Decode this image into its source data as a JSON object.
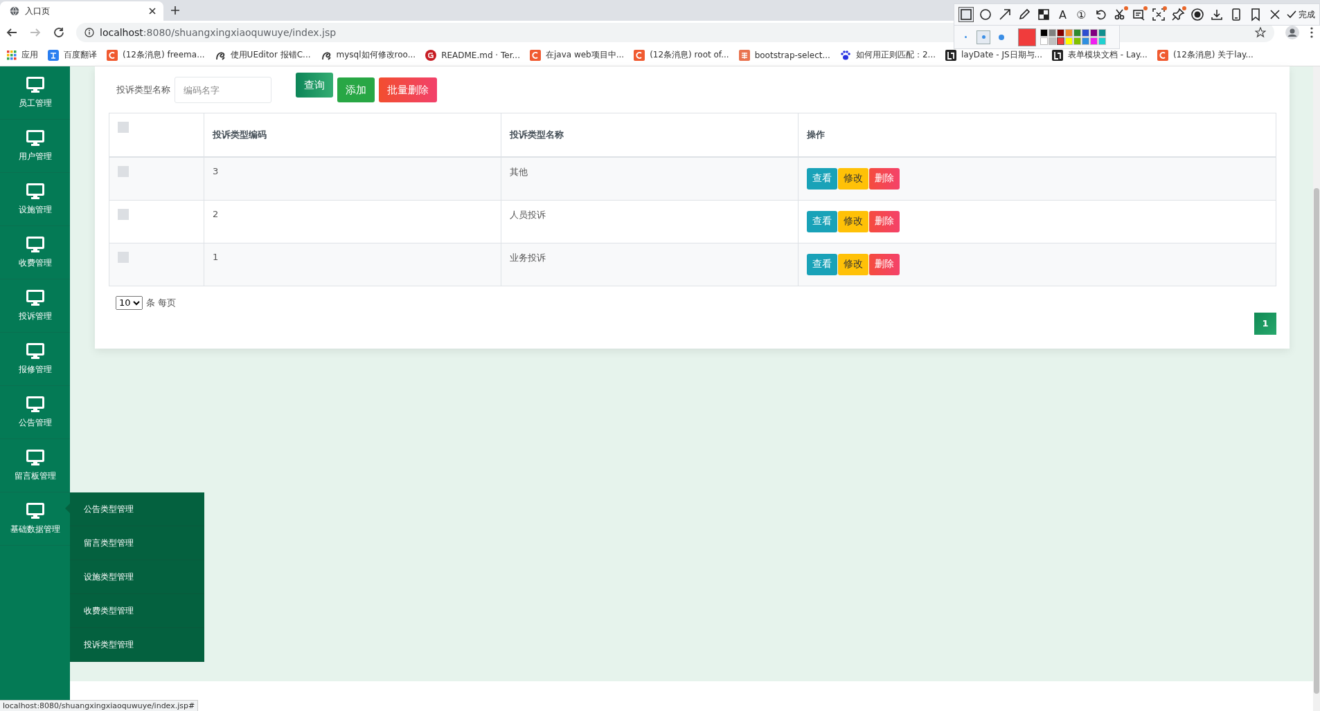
{
  "browser": {
    "tab_title": "入口页",
    "url_host": "localhost",
    "url_path": ":8080/shuangxingxiaoquwuye/index.jsp",
    "bookmarks": [
      {
        "label": "应用",
        "kind": "apps"
      },
      {
        "label": "百度翻译",
        "kind": "translate"
      },
      {
        "label": "(12条消息) freema...",
        "kind": "csdn"
      },
      {
        "label": "使用UEditor 报错C...",
        "kind": "swirl"
      },
      {
        "label": "mysql如何修改roo...",
        "kind": "swirl"
      },
      {
        "label": "README.md · Ter...",
        "kind": "gitee"
      },
      {
        "label": "在java web项目中...",
        "kind": "csdn"
      },
      {
        "label": "(12条消息) root of...",
        "kind": "csdn"
      },
      {
        "label": "bootstrap-select...",
        "kind": "jian"
      },
      {
        "label": "如何用正则匹配：2...",
        "kind": "paw"
      },
      {
        "label": "layDate - JS日期与...",
        "kind": "layui"
      },
      {
        "label": "表单模块文档 - Lay...",
        "kind": "layui"
      },
      {
        "label": "(12条消息) 关于lay...",
        "kind": "csdn"
      }
    ]
  },
  "annotation_toolbar": {
    "tools": [
      {
        "kind": "rect",
        "selected": true
      },
      {
        "kind": "ellipse",
        "selected": false
      },
      {
        "kind": "arrow",
        "selected": false
      },
      {
        "kind": "pencil",
        "selected": false
      },
      {
        "kind": "mosaic",
        "selected": false
      },
      {
        "kind": "text",
        "glyph": "A",
        "selected": false
      },
      {
        "kind": "text",
        "glyph": "①",
        "selected": false
      },
      {
        "kind": "undo",
        "selected": false
      },
      {
        "kind": "scissors",
        "selected": false,
        "badge": true
      },
      {
        "kind": "ocr",
        "selected": false,
        "badge": true
      },
      {
        "kind": "expand",
        "selected": false,
        "badge": true
      },
      {
        "kind": "pin",
        "selected": false,
        "badge": true
      },
      {
        "kind": "record",
        "selected": false
      },
      {
        "kind": "download",
        "selected": false
      },
      {
        "kind": "phone",
        "selected": false
      },
      {
        "kind": "bookmark",
        "selected": false
      },
      {
        "kind": "close",
        "selected": false
      }
    ],
    "done": "完成",
    "brush_sizes": [
      {
        "selected": false
      },
      {
        "selected": true
      },
      {
        "selected": false
      }
    ],
    "palette": [
      {
        "color": "#000000",
        "selected": false
      },
      {
        "color": "#808080",
        "selected": false
      },
      {
        "color": "#800000",
        "selected": false
      },
      {
        "color": "#f08a30",
        "selected": false
      },
      {
        "color": "#2e8b2e",
        "selected": false
      },
      {
        "color": "#2f4fd0",
        "selected": false
      },
      {
        "color": "#800080",
        "selected": false
      },
      {
        "color": "#108f8f",
        "selected": false
      },
      {
        "color": "#ffffff",
        "selected": false
      },
      {
        "color": "#c0c0c0",
        "selected": false
      },
      {
        "color": "#f03c3c",
        "selected": true
      },
      {
        "color": "#ffff00",
        "selected": false
      },
      {
        "color": "#80c000",
        "selected": false
      },
      {
        "color": "#2f8fe0",
        "selected": false
      },
      {
        "color": "#f020f0",
        "selected": false
      },
      {
        "color": "#20d0d0",
        "selected": false
      }
    ]
  },
  "sidebar": {
    "items": [
      {
        "label": "员工管理"
      },
      {
        "label": "用户管理"
      },
      {
        "label": "设施管理"
      },
      {
        "label": "收费管理"
      },
      {
        "label": "投诉管理"
      },
      {
        "label": "报修管理"
      },
      {
        "label": "公告管理"
      },
      {
        "label": "留言板管理"
      },
      {
        "label": "基础数据管理",
        "expanded": true,
        "children": [
          {
            "label": "公告类型管理"
          },
          {
            "label": "留言类型管理"
          },
          {
            "label": "设施类型管理"
          },
          {
            "label": "收费类型管理"
          },
          {
            "label": "投诉类型管理"
          }
        ]
      }
    ]
  },
  "search": {
    "label": "投诉类型名称",
    "placeholder": "编码名字",
    "buttons": [
      {
        "label": "查询",
        "kind": "search"
      },
      {
        "label": "添加",
        "kind": "add"
      },
      {
        "label": "批量删除",
        "kind": "delete"
      }
    ]
  },
  "table": {
    "select_all": {
      "checked": false
    },
    "columns": [
      "投诉类型编码",
      "投诉类型名称",
      "操作"
    ],
    "rows": [
      {
        "checked": false,
        "code": "3",
        "name": "其他",
        "actions": [
          {
            "label": "查看",
            "kind": "view"
          },
          {
            "label": "修改",
            "kind": "edit"
          },
          {
            "label": "删除",
            "kind": "delete"
          }
        ]
      },
      {
        "checked": false,
        "code": "2",
        "name": "人员投诉",
        "actions": [
          {
            "label": "查看",
            "kind": "view"
          },
          {
            "label": "修改",
            "kind": "edit"
          },
          {
            "label": "删除",
            "kind": "delete"
          }
        ]
      },
      {
        "checked": false,
        "code": "1",
        "name": "业务投诉",
        "actions": [
          {
            "label": "查看",
            "kind": "view"
          },
          {
            "label": "修改",
            "kind": "edit"
          },
          {
            "label": "删除",
            "kind": "delete"
          }
        ]
      }
    ]
  },
  "pagination": {
    "page_size": "10",
    "per_page_label": "条 每页",
    "pages": [
      {
        "label": "1",
        "selected": true
      }
    ]
  },
  "status_bar": {
    "url": "localhost:8080/shuangxingxiaoquwuye/index.jsp#"
  }
}
